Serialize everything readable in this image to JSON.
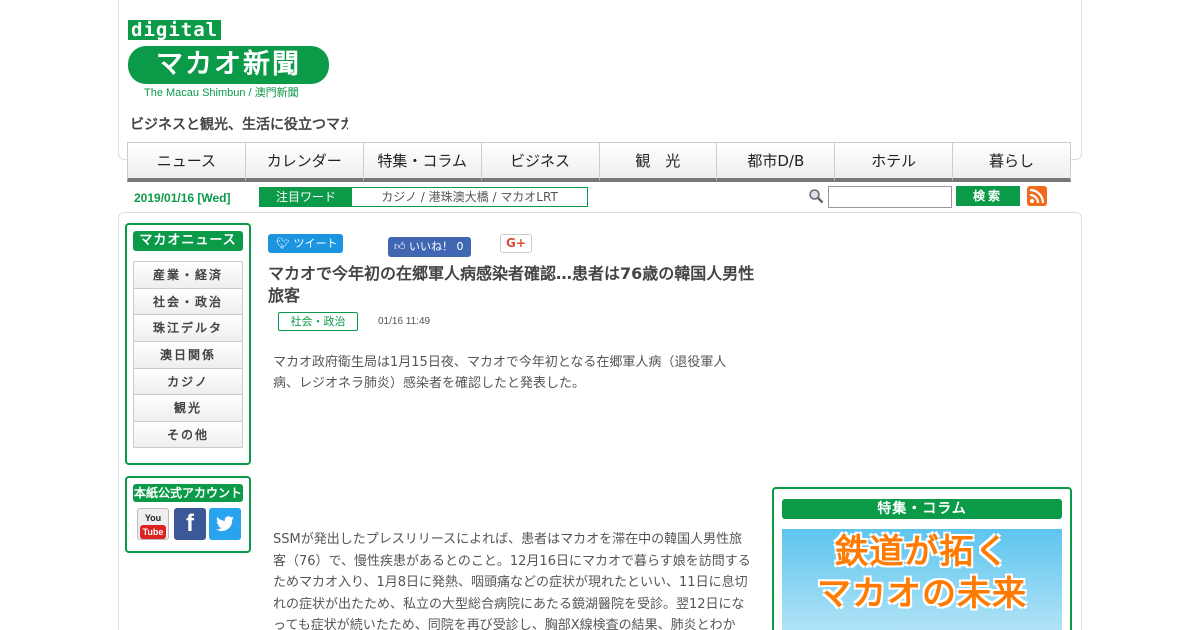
{
  "header": {
    "logo_digital": "digital",
    "logo_main": "マカオ新聞",
    "logo_sub": "The Macau Shimbun / 澳門新聞",
    "tagline": "ビジネスと観光、生活に役立つマカオ"
  },
  "nav": {
    "items": [
      "ニュース",
      "カレンダー",
      "特集・コラム",
      "ビジネス",
      "観　光",
      "都市D/B",
      "ホテル",
      "暮らし"
    ]
  },
  "topbar": {
    "date": "2019/01/16 [Wed]",
    "keyword_label": "注目ワード",
    "keywords": "カジノ / 港珠澳大橋 / マカオLRT",
    "search_placeholder": "",
    "search_button": "検索"
  },
  "sidebar": {
    "title": "マカオニュース",
    "categories": [
      "産業・経済",
      "社会・政治",
      "珠江デルタ",
      "澳日関係",
      "カジノ",
      "観光",
      "その他"
    ],
    "accounts_title": "本紙公式アカウント",
    "youtube_label": "You",
    "youtube_label2": "Tube",
    "facebook_label": "f"
  },
  "social": {
    "tweet": "ツイート",
    "like": "いいね！ 0",
    "gplus": "G+"
  },
  "article": {
    "title": "マカオで今年初の在郷軍人病感染者確認…患者は76歳の韓国人男性旅客",
    "category": "社会・政治",
    "time": "01/16 11:49",
    "lead": "マカオ政府衛生局は1月15日夜、マカオで今年初となる在郷軍人病（退役軍人病、レジオネラ肺炎）感染者を確認したと発表した。",
    "body": "SSMが発出したプレスリリースによれば、患者はマカオを滞在中の韓国人男性旅客（76）で、慢性疾患があるとのこと。12月16日にマカオで暮らす娘を訪問するためマカオ入り、1月8日に発熱、咽頭痛などの症状が現れたといい、11日に息切れの症状が出たため、私立の大型総合病院にあたる鏡湖醫院を受診。翌12日になっても症状が続いたため、同院を再び受診し、胸部X線検査の結果、肺炎とわか"
  },
  "feature": {
    "title": "特集・コラム",
    "banner_line1": "鉄道が拓く",
    "banner_line2": "マカオの未来"
  },
  "colors": {
    "brand_green": "#0a9a48",
    "tweet_blue": "#1b95e0",
    "facebook_blue": "#4267b2",
    "rss_orange": "#f26a1b"
  }
}
